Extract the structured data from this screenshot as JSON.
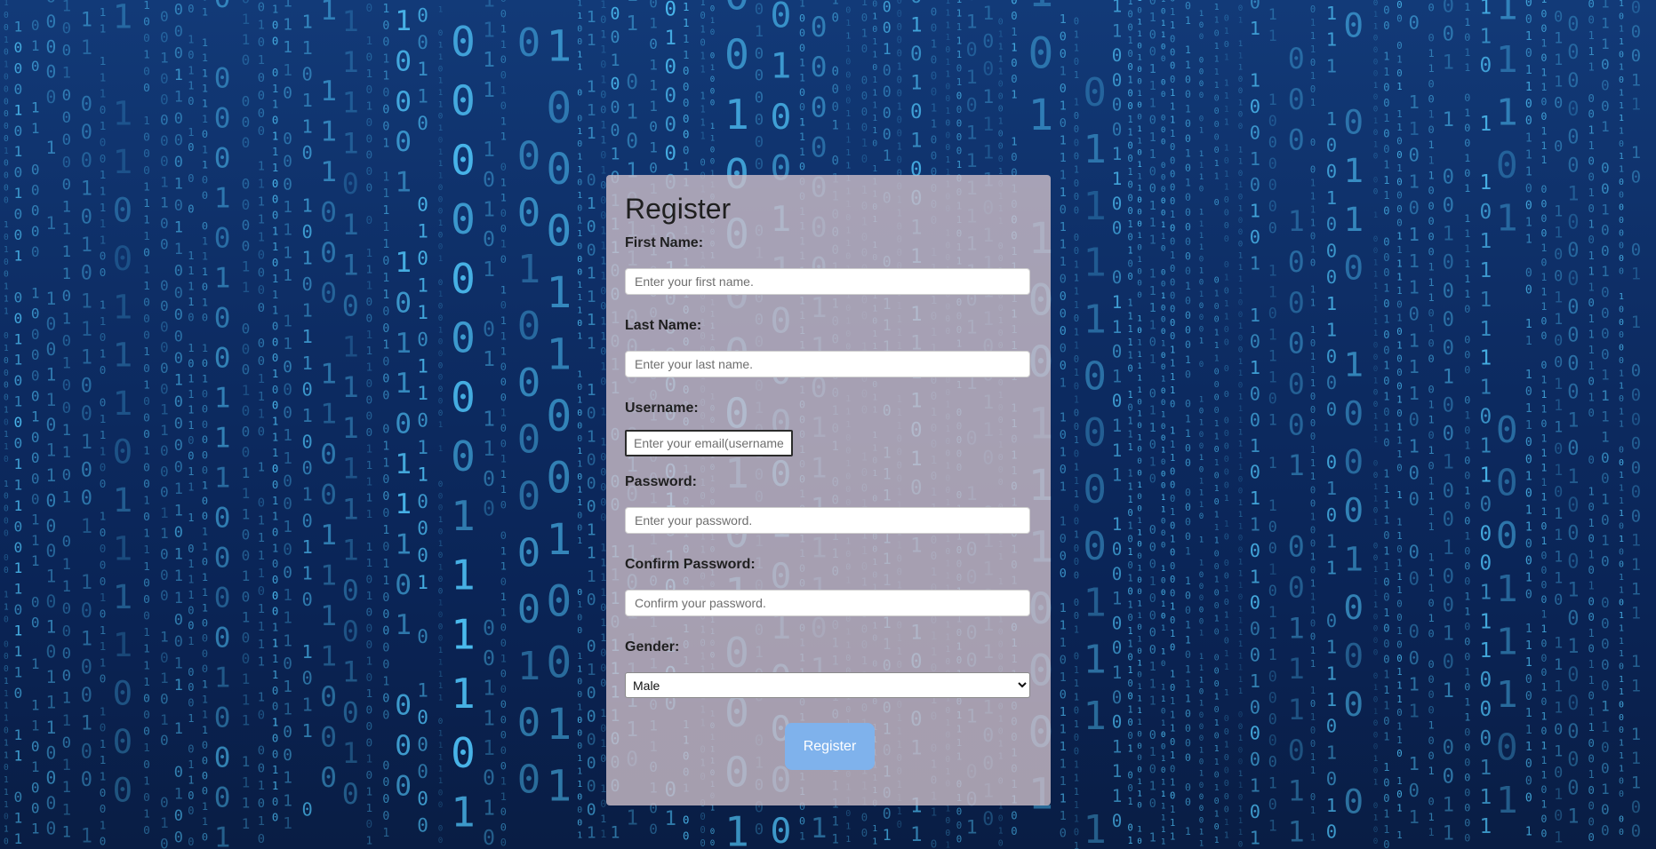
{
  "form": {
    "title": "Register",
    "first_name": {
      "label": "First Name:",
      "placeholder": "Enter your first name."
    },
    "last_name": {
      "label": "Last Name:",
      "placeholder": "Enter your last name."
    },
    "username": {
      "label": "Username:",
      "placeholder": "Enter your email(username)"
    },
    "password": {
      "label": "Password:",
      "placeholder": "Enter your password."
    },
    "confirm_password": {
      "label": "Confirm Password:",
      "placeholder": "Confirm your password."
    },
    "gender": {
      "label": "Gender:",
      "selected": "Male",
      "options": [
        "Male"
      ]
    },
    "submit_label": "Register"
  },
  "colors": {
    "background": "#0d2c63",
    "binary_digits": "#4fc3f7",
    "card": "#cdbec8",
    "button": "#7fb2ec"
  },
  "background": {
    "icon": "binary-matrix-rain"
  }
}
